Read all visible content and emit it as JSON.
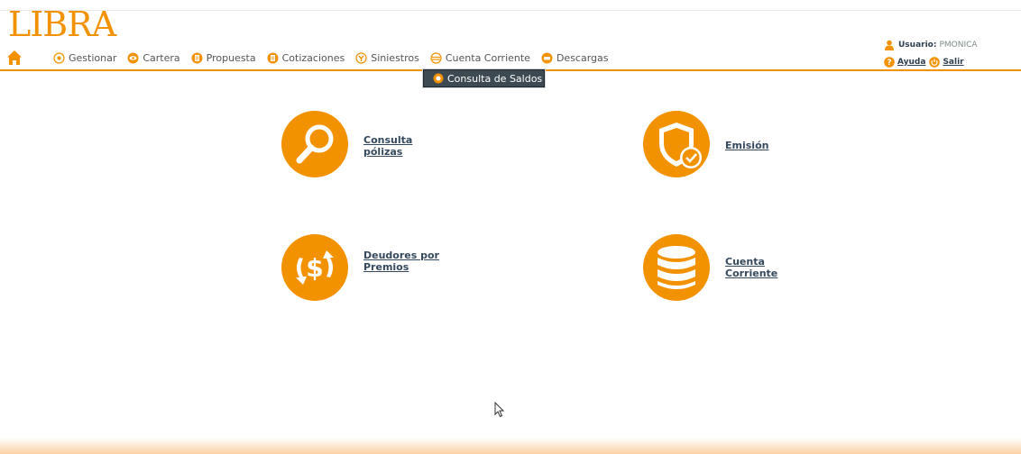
{
  "brand": {
    "logo": "LIBRA",
    "accent": "#f39200"
  },
  "nav": {
    "items": [
      {
        "label": "Gestionar",
        "icon": "gear-icon"
      },
      {
        "label": "Cartera",
        "icon": "eye-icon"
      },
      {
        "label": "Propuesta",
        "icon": "document-icon"
      },
      {
        "label": "Cotizaciones",
        "icon": "document-icon"
      },
      {
        "label": "Siniestros",
        "icon": "wrench-icon"
      },
      {
        "label": "Cuenta Corriente",
        "icon": "database-icon"
      },
      {
        "label": "Descargas",
        "icon": "download-icon"
      }
    ],
    "dropdown_item": "Consulta de Saldos"
  },
  "user": {
    "label": "Usuario:",
    "name": "PMONICA",
    "help": "Ayuda",
    "logout": "Salir"
  },
  "tiles": {
    "consulta": "Consulta pólizas",
    "emision": "Emisión",
    "deudores": "Deudores por Premios",
    "cuenta": "Cuenta Corriente"
  }
}
